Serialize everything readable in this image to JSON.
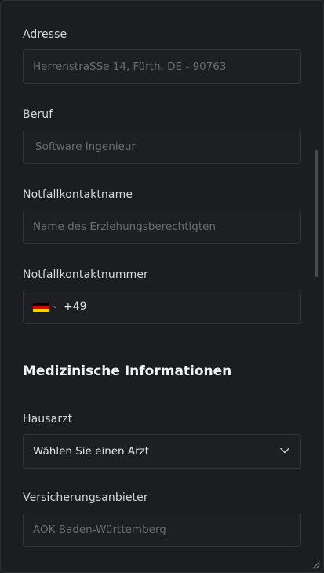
{
  "fields": {
    "address": {
      "label": "Adresse",
      "placeholder": "HerrenstraSSe 14, Fürth, DE - 90763"
    },
    "occupation": {
      "label": "Beruf",
      "placeholder": "Software Ingenieur"
    },
    "emergency_name": {
      "label": "Notfallkontaktname",
      "placeholder": "Name des Erziehungsberechtigten"
    },
    "emergency_number": {
      "label": "Notfallkontaktnummer",
      "dial_code": "+49",
      "country_flag": "germany-flag-icon"
    }
  },
  "medical": {
    "title": "Medizinische Informationen",
    "physician": {
      "label": "Hausarzt",
      "value": "Wählen Sie einen Arzt",
      "icon": "chevron-down-icon"
    },
    "insurance": {
      "label": "Versicherungsanbieter",
      "placeholder": "AOK Baden-Württemberg"
    }
  },
  "colors": {
    "background": "#1c1d1f",
    "input_bg": "#1e1f22",
    "input_border": "#323438",
    "label": "#d6d7db",
    "placeholder": "#6b6d73",
    "value": "#e3e4e7"
  }
}
